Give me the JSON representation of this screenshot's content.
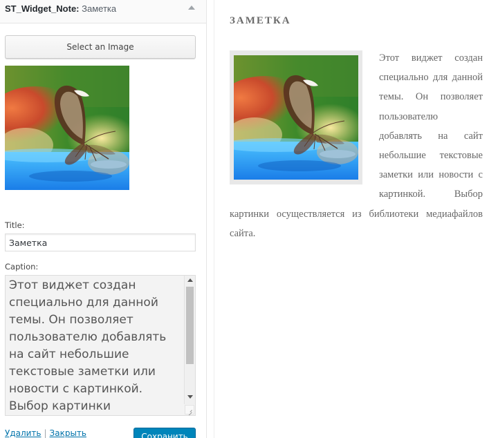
{
  "widget_panel": {
    "title": "ST_Widget_Note:",
    "title_suffix": "Заметка",
    "select_image_label": "Select an Image",
    "title_label": "Title:",
    "title_value": "Заметка",
    "caption_label": "Caption:",
    "caption_value": "Этот виджет создан\nспециально для данной\nтемы. Он позволяет\nпользователю добавлять\nна сайт небольшие\nтекстовые заметки или\nновости с картинкой.\nВыбор картинки",
    "delete_link": "Удалить",
    "link_separator": "|",
    "close_link": "Закрыть",
    "save_label": "Сохранить"
  },
  "preview": {
    "title": "ЗАМЕТКА",
    "text": "Этот виджет создан специально для данной темы. Он позволяет пользователю добавлять на сайт небольшие текстовые заметки или новости с картинкой. Выбор картинки осуществляется из библиотеки медиафайлов сайта."
  },
  "colors": {
    "link": "#0073aa",
    "primary_button": "#0085ba",
    "preview_text": "#666666"
  },
  "icons": {
    "collapse": "arrow-up-icon",
    "image": "butterfly-image"
  }
}
